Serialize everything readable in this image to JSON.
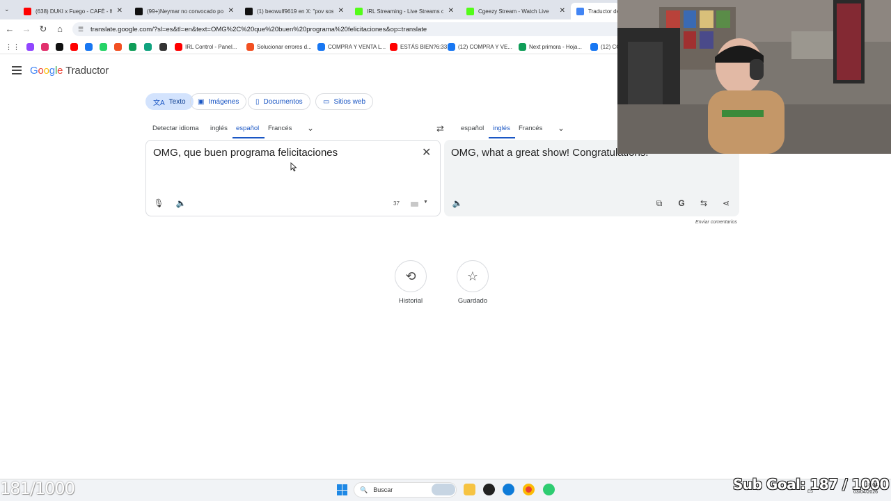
{
  "browser": {
    "tabs": [
      {
        "title": "(638) DUKI x Fuego - CAFÉ - ft.",
        "icon": "youtube-icon",
        "color": "#ff0000"
      },
      {
        "title": "(99+)Neymar no convocado po",
        "icon": "tiktok-icon",
        "color": "#111111"
      },
      {
        "title": "(1) beowulf9619 en X: \"pov sos",
        "icon": "x-icon",
        "color": "#111111"
      },
      {
        "title": "IRL Streaming - Live Streams o",
        "icon": "kick-icon",
        "color": "#53fc18"
      },
      {
        "title": "Cgeezy Stream - Watch Live",
        "icon": "kick-icon",
        "color": "#53fc18"
      },
      {
        "title": "Traductor de",
        "icon": "google-translate-icon",
        "color": "#4285f4"
      }
    ],
    "url": "translate.google.com/?sl=es&tl=en&text=OMG%2C%20que%20buen%20programa%20felicitaciones&op=translate",
    "bookmarks": [
      {
        "label": "",
        "icon": "twitch-icon",
        "color": "#9146ff"
      },
      {
        "label": "",
        "icon": "instagram-icon",
        "color": "#e1306c"
      },
      {
        "label": "",
        "icon": "x-icon",
        "color": "#111111"
      },
      {
        "label": "",
        "icon": "youtube-icon",
        "color": "#ff0000"
      },
      {
        "label": "",
        "icon": "facebook-icon",
        "color": "#1877f2"
      },
      {
        "label": "",
        "icon": "whatsapp-icon",
        "color": "#25d366"
      },
      {
        "label": "",
        "icon": "microsoft-icon",
        "color": "#f25022"
      },
      {
        "label": "",
        "icon": "photos-icon",
        "color": "#0f9d58"
      },
      {
        "label": "",
        "icon": "chatgpt-icon",
        "color": "#10a37f"
      },
      {
        "label": "",
        "icon": "github-icon",
        "color": "#333333"
      },
      {
        "label": "IRL Control - Panel...",
        "icon": "youtube-icon",
        "color": "#ff0000"
      },
      {
        "label": "Solucionar errores d...",
        "icon": "microsoft-icon",
        "color": "#f25022"
      },
      {
        "label": "COMPRA Y VENTA L...",
        "icon": "facebook-icon",
        "color": "#1877f2"
      },
      {
        "label": "ESTÁS BIEN?6:33",
        "icon": "youtube-icon",
        "color": "#ff0000"
      },
      {
        "label": "(12) COMPRA Y VE...",
        "icon": "facebook-icon",
        "color": "#1877f2"
      },
      {
        "label": "Next primora - Hoja...",
        "icon": "sheets-icon",
        "color": "#0f9d58"
      },
      {
        "label": "(12) CO",
        "icon": "facebook-icon",
        "color": "#1877f2"
      }
    ]
  },
  "translate": {
    "logo_google": "Google",
    "logo_product": "Traductor",
    "modes": [
      "Texto",
      "Imágenes",
      "Documentos",
      "Sitios web"
    ],
    "source_langs": [
      "Detectar idioma",
      "inglés",
      "español",
      "Francés"
    ],
    "target_langs": [
      "español",
      "inglés",
      "Francés"
    ],
    "source_text": "OMG, que buen programa felicitaciones",
    "target_text": "OMG, what a great show! Congratulations.",
    "char_count": "37",
    "feedback": "Enviar comentarios",
    "history_label": "Historial",
    "saved_label": "Guardado"
  },
  "overlay": {
    "left_counter": "181/1000",
    "sub_goal": "Sub Goal: 187 / 1000"
  },
  "taskbar": {
    "search_placeholder": "Buscar",
    "language": "ES",
    "time": "18:04",
    "date": "03/04/2026"
  }
}
